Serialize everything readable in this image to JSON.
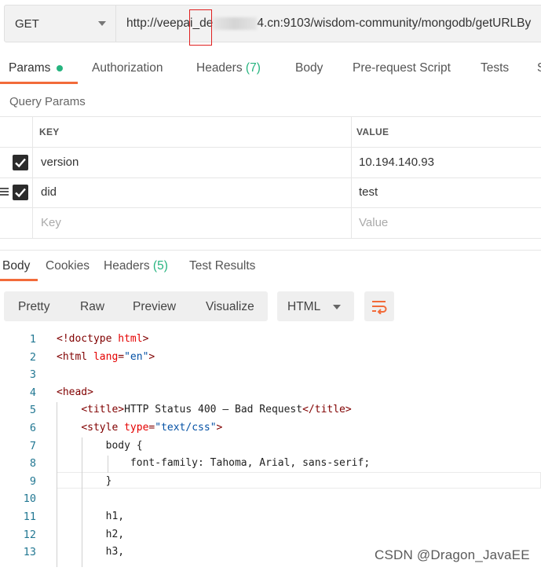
{
  "request": {
    "method": "GET",
    "url_prefix": "http://veepai_de",
    "url_suffix": "4.cn:9103/wisdom-community/mongodb/getURLBy"
  },
  "request_tabs": {
    "params": "Params",
    "authorization": "Authorization",
    "headers": "Headers",
    "headers_count": "(7)",
    "body": "Body",
    "prerequest": "Pre-request Script",
    "tests": "Tests",
    "settings_fragment": "S"
  },
  "query_params": {
    "title": "Query Params",
    "col_key": "KEY",
    "col_value": "VALUE",
    "rows": [
      {
        "key": "version",
        "value": "10.194.140.93",
        "checked": true
      },
      {
        "key": "did",
        "value": "test",
        "checked": true
      }
    ],
    "key_placeholder": "Key",
    "value_placeholder": "Value"
  },
  "response_tabs": {
    "body": "Body",
    "cookies": "Cookies",
    "headers": "Headers",
    "headers_count": "(5)",
    "test_results": "Test Results"
  },
  "view_modes": {
    "pretty": "Pretty",
    "raw": "Raw",
    "preview": "Preview",
    "visualize": "Visualize",
    "language": "HTML"
  },
  "code": {
    "line_numbers": [
      "1",
      "2",
      "3",
      "4",
      "5",
      "6",
      "7",
      "8",
      "9",
      "10",
      "11",
      "12",
      "13"
    ],
    "lines": [
      [
        {
          "t": "<!doctype ",
          "c": "tag"
        },
        {
          "t": "html",
          "c": "attr"
        },
        {
          "t": ">",
          "c": "tag"
        }
      ],
      [
        {
          "t": "<html ",
          "c": "tag"
        },
        {
          "t": "lang",
          "c": "attr"
        },
        {
          "t": "=",
          "c": "tag"
        },
        {
          "t": "\"en\"",
          "c": "str"
        },
        {
          "t": ">",
          "c": "tag"
        }
      ],
      [],
      [
        {
          "t": "<head>",
          "c": "tag"
        }
      ],
      [
        {
          "t": "    "
        },
        {
          "t": "<title>",
          "c": "tag"
        },
        {
          "t": "HTTP Status 400 – Bad Request"
        },
        {
          "t": "</title>",
          "c": "tag"
        }
      ],
      [
        {
          "t": "    "
        },
        {
          "t": "<style ",
          "c": "tag"
        },
        {
          "t": "type",
          "c": "attr"
        },
        {
          "t": "=",
          "c": "tag"
        },
        {
          "t": "\"text/css\"",
          "c": "str"
        },
        {
          "t": ">",
          "c": "tag"
        }
      ],
      [
        {
          "t": "        body {"
        }
      ],
      [
        {
          "t": "            font-family: Tahoma, Arial, sans-serif;"
        }
      ],
      [
        {
          "t": "        }"
        }
      ],
      [],
      [
        {
          "t": "        h1,"
        }
      ],
      [
        {
          "t": "        h2,"
        }
      ],
      [
        {
          "t": "        h3,"
        }
      ]
    ]
  },
  "watermark": "CSDN @Dragon_JavaEE",
  "colors": {
    "accent": "#f26b3a",
    "success": "#26b47f"
  }
}
